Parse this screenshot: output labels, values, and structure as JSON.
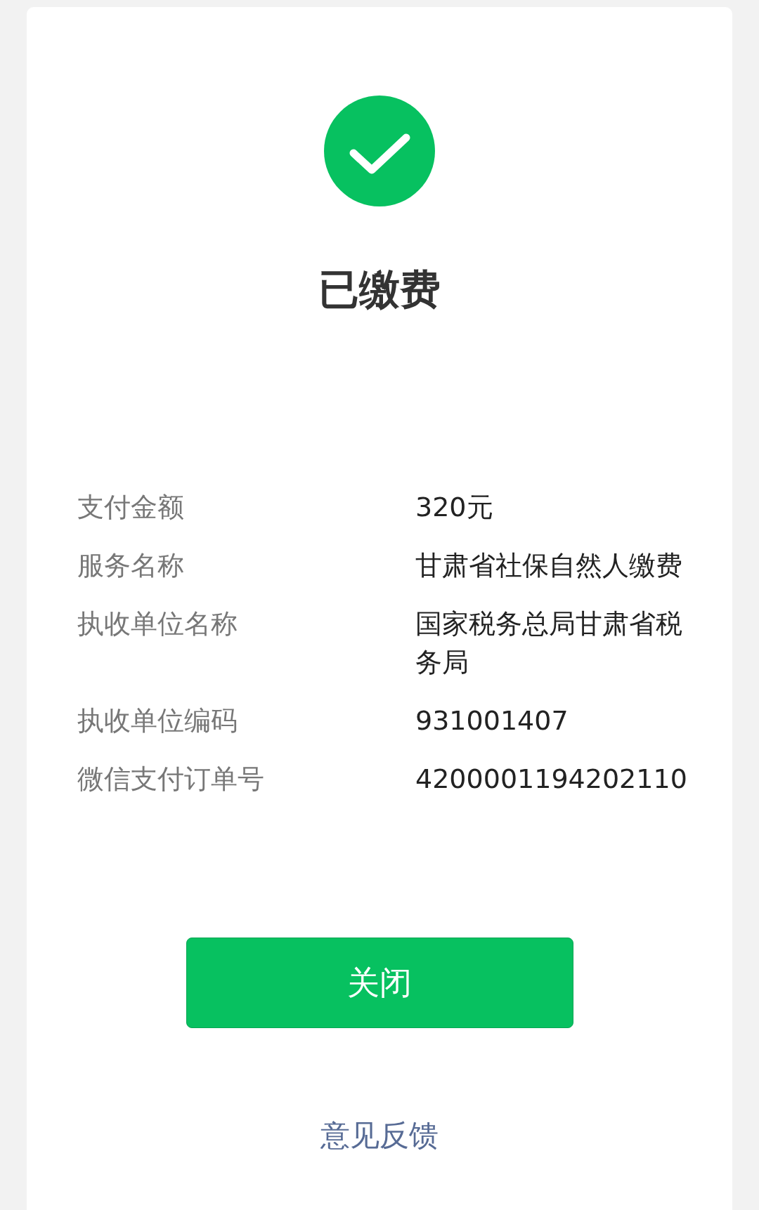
{
  "status": {
    "title": "已缴费"
  },
  "details": [
    {
      "label": "支付金额",
      "value": "320元"
    },
    {
      "label": "服务名称",
      "value": "甘肃省社保自然人缴费"
    },
    {
      "label": "执收单位名称",
      "value": "国家税务总局甘肃省税务局"
    },
    {
      "label": "执收单位编码",
      "value": "931001407"
    },
    {
      "label": "微信支付订单号",
      "value": "4200001194202110"
    }
  ],
  "close_button": {
    "label": "关闭"
  },
  "feedback_link": {
    "label": "意见反馈"
  }
}
